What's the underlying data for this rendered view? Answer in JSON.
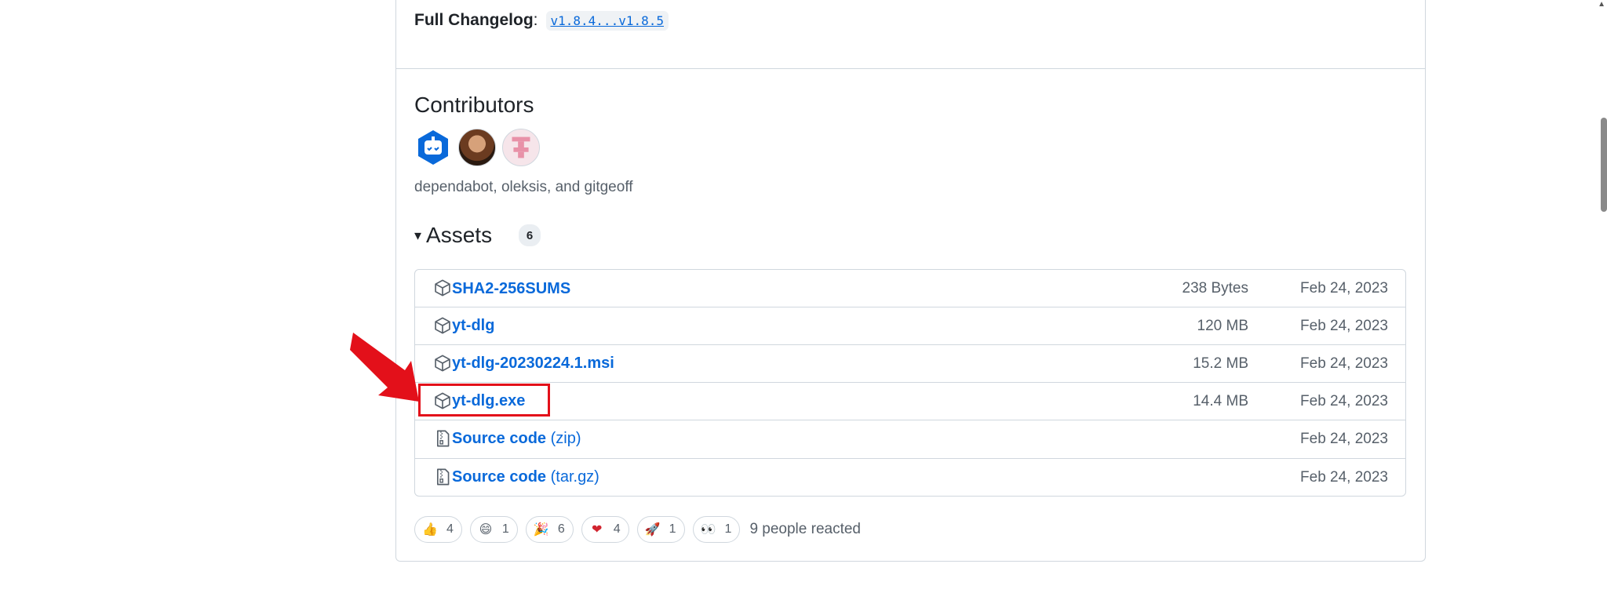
{
  "changelog": {
    "label": "Full Changelog",
    "colon": ":",
    "compare": "v1.8.4...v1.8.5"
  },
  "contributors": {
    "title": "Contributors",
    "names": "dependabot, oleksis, and gitgeoff"
  },
  "assets": {
    "toggle": "▾",
    "title": "Assets",
    "count": "6",
    "rows": [
      {
        "name": "SHA2-256SUMS",
        "suffix": "",
        "size": "238 Bytes",
        "date": "Feb 24, 2023",
        "icon": "package-icon"
      },
      {
        "name": "yt-dlg",
        "suffix": "",
        "size": "120 MB",
        "date": "Feb 24, 2023",
        "icon": "package-icon"
      },
      {
        "name": "yt-dlg-20230224.1.msi",
        "suffix": "",
        "size": "15.2 MB",
        "date": "Feb 24, 2023",
        "icon": "package-icon"
      },
      {
        "name": "yt-dlg.exe",
        "suffix": "",
        "size": "14.4 MB",
        "date": "Feb 24, 2023",
        "icon": "package-icon"
      },
      {
        "name": "Source code",
        "suffix": "(zip)",
        "size": "",
        "date": "Feb 24, 2023",
        "icon": "file-zip-icon"
      },
      {
        "name": "Source code",
        "suffix": "(tar.gz)",
        "size": "",
        "date": "Feb 24, 2023",
        "icon": "file-zip-icon"
      }
    ]
  },
  "reactions": {
    "items": [
      {
        "emoji": "👍",
        "count": "4",
        "name": "thumbs-up"
      },
      {
        "emoji": "😄",
        "count": "1",
        "name": "laugh"
      },
      {
        "emoji": "🎉",
        "count": "6",
        "name": "hooray"
      },
      {
        "emoji": "❤",
        "count": "4",
        "name": "heart"
      },
      {
        "emoji": "🚀",
        "count": "1",
        "name": "rocket"
      },
      {
        "emoji": "👀",
        "count": "1",
        "name": "eyes"
      }
    ],
    "summary": "9 people reacted"
  },
  "colors": {
    "link": "#0969da",
    "highlight": "#e3101a",
    "muted": "#57606a",
    "border": "#d0d7de"
  }
}
